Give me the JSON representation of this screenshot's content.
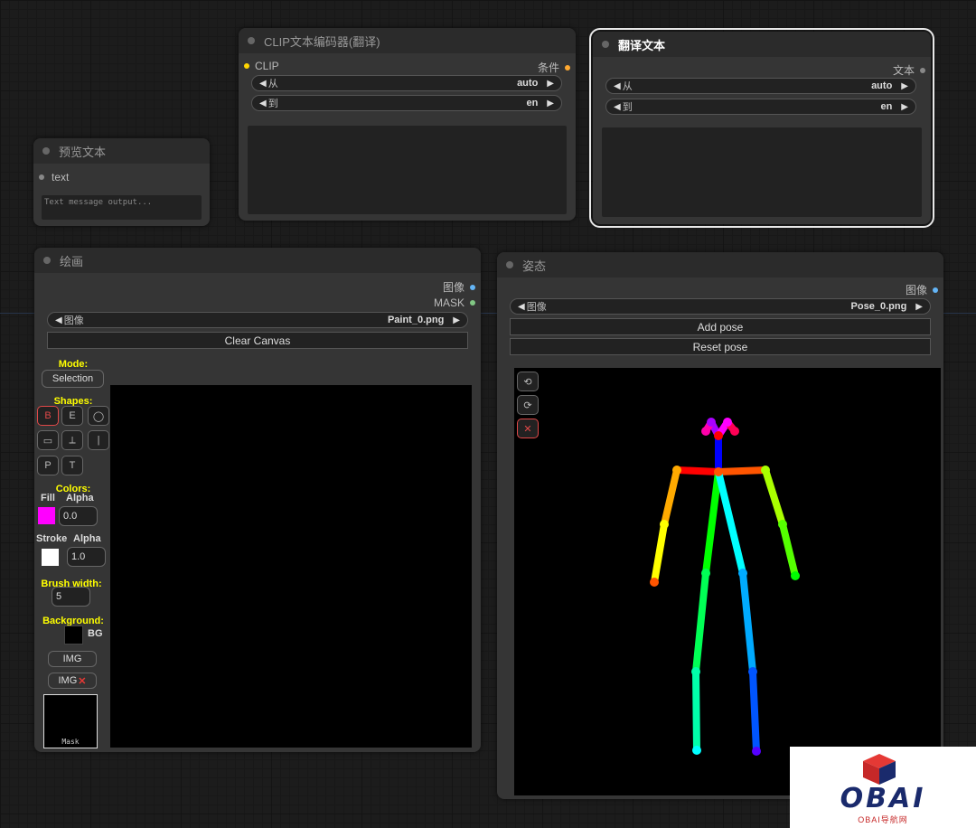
{
  "nodes": {
    "clip_translate": {
      "title": "CLIP文本编码器(翻译)",
      "input_clip": "CLIP",
      "output_cond": "条件",
      "from_label": "从",
      "from_value": "auto",
      "to_label": "到",
      "to_value": "en"
    },
    "translate_text": {
      "title": "翻译文本",
      "output_text": "文本",
      "from_label": "从",
      "from_value": "auto",
      "to_label": "到",
      "to_value": "en"
    },
    "preview_text": {
      "title": "预览文本",
      "input_text": "text",
      "placeholder": "Text message output..."
    },
    "painter": {
      "title": "绘画",
      "output_image": "图像",
      "output_mask": "MASK",
      "image_label": "图像",
      "image_value": "Paint_0.png",
      "clear_button": "Clear Canvas",
      "mode_label": "Mode:",
      "mode_value": "Selection",
      "shapes_label": "Shapes:",
      "shapes": [
        "B",
        "E",
        "◯",
        "▭",
        "⟂",
        "|",
        "P",
        "T"
      ],
      "colors_label": "Colors:",
      "fill_label": "Fill",
      "alpha_label": "Alpha",
      "fill_color": "#ff00ff",
      "fill_alpha": "0.0",
      "stroke_label": "Stroke",
      "stroke_color": "#ffffff",
      "stroke_alpha": "1.0",
      "brush_label": "Brush width:",
      "brush_value": "5",
      "background_label": "Background:",
      "bg_label": "BG",
      "bg_color": "#000000",
      "img_button": "IMG",
      "img_remove_button": "IMG",
      "mask_label": "Mask"
    },
    "pose": {
      "title": "姿态",
      "output_image": "图像",
      "image_label": "图像",
      "image_value": "Pose_0.png",
      "add_button": "Add pose",
      "reset_button": "Reset pose"
    }
  },
  "logo": {
    "text": "OBAI",
    "subtext": "OBAI导航网"
  },
  "colors": {
    "clip": "#ffd500",
    "cond": "#ffa931",
    "image": "#64b5f6",
    "mask": "#81c784"
  }
}
